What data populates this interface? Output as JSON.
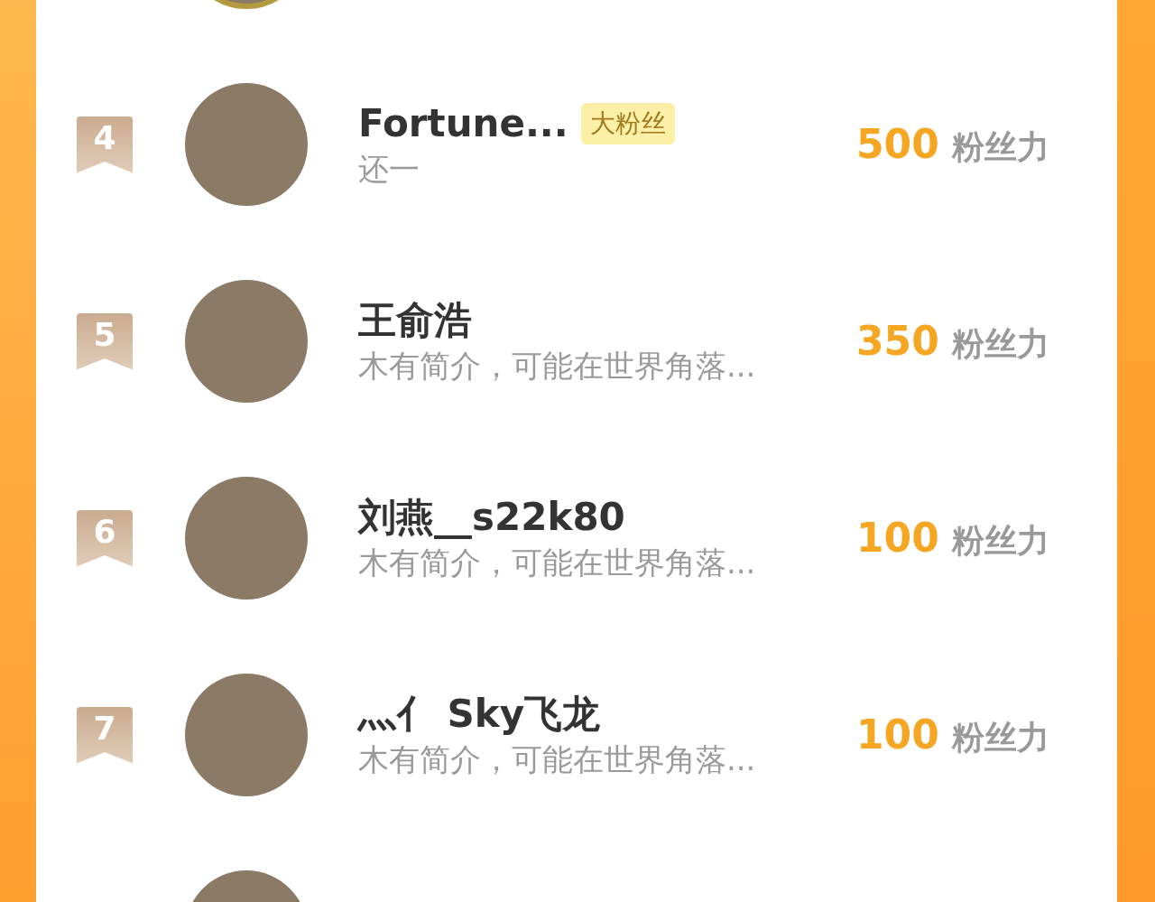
{
  "entries": [
    {
      "medal": true
    },
    {
      "medal": false,
      "rank": "4",
      "name": "Fortune...",
      "badge": "大粉丝",
      "bio": "还一",
      "score": "500",
      "unit": "粉丝力"
    },
    {
      "medal": false,
      "rank": "5",
      "name": "王俞浩",
      "bio": "木有简介，可能在世界角落...",
      "score": "350",
      "unit": "粉丝力"
    },
    {
      "medal": false,
      "rank": "6",
      "name": "刘燕__s22k80",
      "bio": "木有简介，可能在世界角落...",
      "score": "100",
      "unit": "粉丝力"
    },
    {
      "medal": false,
      "rank": "7",
      "name": "灬亻 Sky飞龙",
      "bio": "木有简介，可能在世界角落...",
      "score": "100",
      "unit": "粉丝力"
    },
    {
      "medal": false
    }
  ]
}
